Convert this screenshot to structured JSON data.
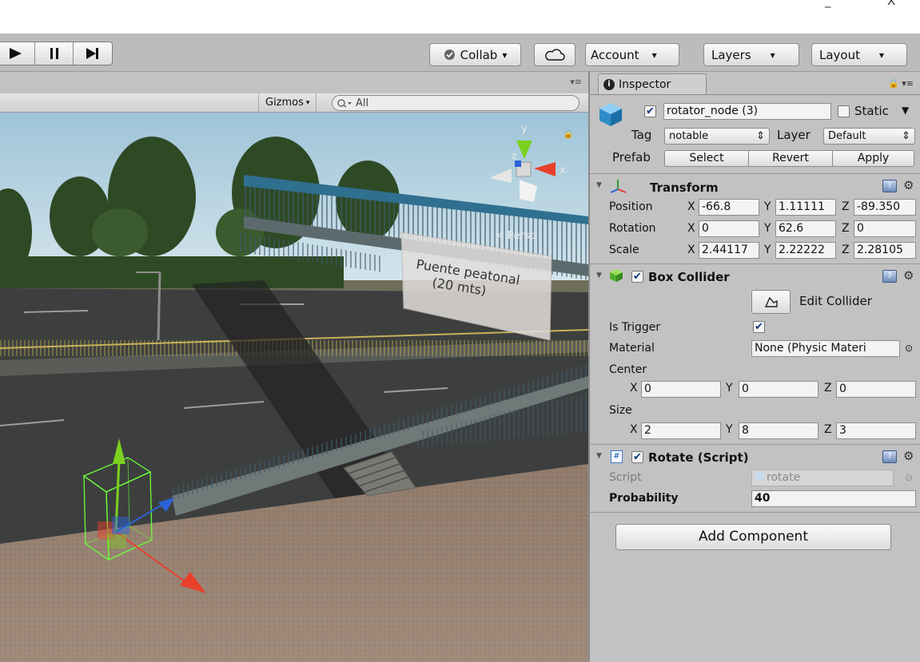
{
  "window": {
    "minimize_glyph": "_",
    "close_glyph": "X"
  },
  "toolbar": {
    "play_icons": [
      "play-icon",
      "pause-icon",
      "step-icon"
    ],
    "collab_label": "Collab",
    "cloud_icon": "cloud-icon",
    "account_label": "Account",
    "layers_label": "Layers",
    "layout_label": "Layout",
    "dropdown_glyph": "▾"
  },
  "scene": {
    "gizmos_label": "Gizmos",
    "search_placeholder": "All",
    "persp_label": "< Persp",
    "axis_labels": {
      "x": "x",
      "y": "y",
      "z": "z"
    },
    "sign_text_line1": "Puente peatonal",
    "sign_text_line2": "(20 mts)"
  },
  "inspector": {
    "tab_label": "Inspector",
    "object_name": "rotator_node (3)",
    "active_checked": true,
    "static_label": "Static",
    "tag_label": "Tag",
    "tag_value": "notable",
    "layer_label": "Layer",
    "layer_value": "Default",
    "prefab_label": "Prefab",
    "prefab_buttons": [
      "Select",
      "Revert",
      "Apply"
    ],
    "transform": {
      "title": "Transform",
      "rows": [
        {
          "label": "Position",
          "x": "-66.8",
          "y": "1.11111",
          "z": "-89.350"
        },
        {
          "label": "Rotation",
          "x": "0",
          "y": "62.6",
          "z": "0"
        },
        {
          "label": "Scale",
          "x": "2.44117",
          "y": "2.22222",
          "z": "2.28105"
        }
      ]
    },
    "box_collider": {
      "title": "Box Collider",
      "edit_label": "Edit Collider",
      "is_trigger_label": "Is Trigger",
      "is_trigger": true,
      "material_label": "Material",
      "material_value": "None (Physic Materi",
      "center_label": "Center",
      "center": {
        "x": "0",
        "y": "0",
        "z": "0"
      },
      "size_label": "Size",
      "size": {
        "x": "2",
        "y": "8",
        "z": "3"
      }
    },
    "rotate_script": {
      "title": "Rotate (Script)",
      "script_label": "Script",
      "script_value": "rotate",
      "probability_label": "Probability",
      "probability_value": "40"
    },
    "add_component_label": "Add Component",
    "axis": {
      "x": "X",
      "y": "Y",
      "z": "Z"
    }
  },
  "colors": {
    "gizmo_y": "#7bd11e",
    "gizmo_x": "#e8402a",
    "gizmo_z": "#2a63d8",
    "sky_top": "#9ec4d8",
    "collider_wire": "#6cff3a"
  }
}
